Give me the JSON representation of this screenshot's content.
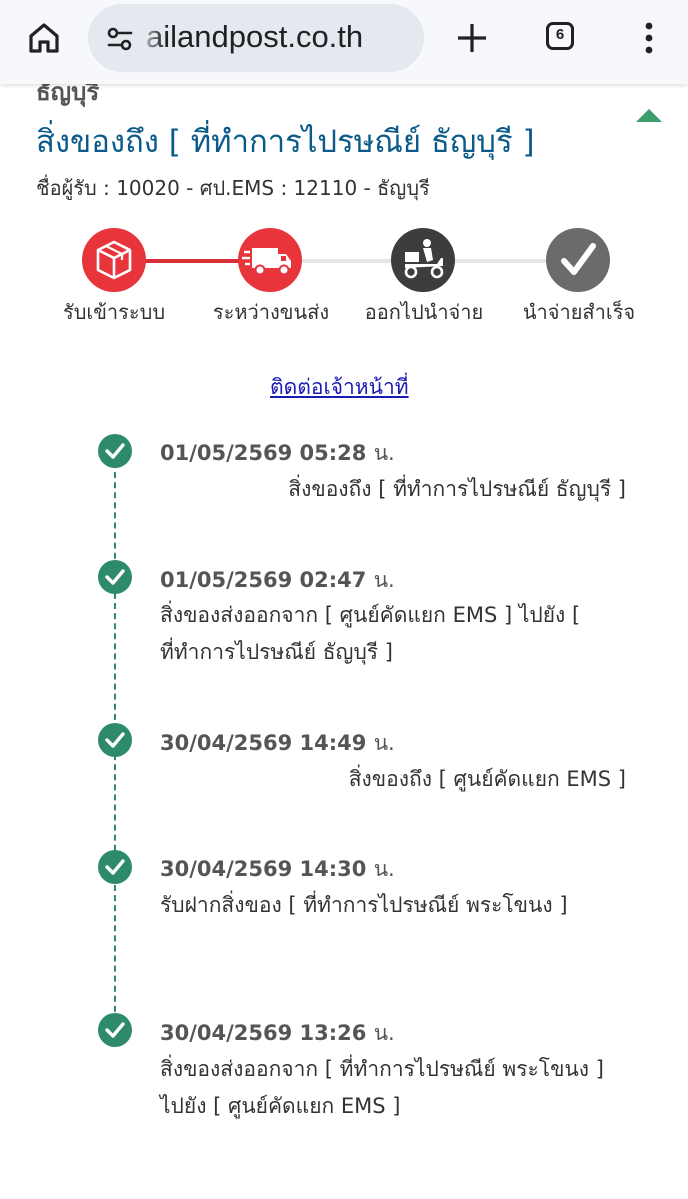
{
  "browser": {
    "url": "ailandpost.co.th",
    "tab_count": "6",
    "icons": [
      "home-icon",
      "site-info-icon",
      "plus-icon",
      "tabs-icon",
      "more-vert-icon"
    ]
  },
  "header": {
    "cut_text": "ธัญบุรี",
    "title": "สิ่งของถึง [ ที่ทำการไปรษณีย์ ธัญบุรี ]",
    "recipient": "ชื่อผู้รับ : 10020 - ศป.EMS : 12110 - ธัญบุรี"
  },
  "progress": {
    "steps": [
      {
        "label": "รับเข้าระบบ",
        "icon": "package-icon",
        "color": "#e8343b"
      },
      {
        "label": "ระหว่างขนส่ง",
        "icon": "truck-icon",
        "color": "#e8343b"
      },
      {
        "label": "ออกไปนำจ่าย",
        "icon": "scooter-icon",
        "color": "#3d3d3d"
      },
      {
        "label": "นำจ่ายสำเร็จ",
        "icon": "checkmark-icon",
        "color": "#6b6b6b"
      }
    ],
    "completed_steps": 2
  },
  "contact": {
    "label": "ติดต่อเจ้าหน้าที่"
  },
  "timeline": {
    "unit": "น.",
    "events": [
      {
        "datetime": "01/05/2569 05:28",
        "desc": "สิ่งของถึง [ ที่ทำการไปรษณีย์ ธัญบุรี ]"
      },
      {
        "datetime": "01/05/2569 02:47",
        "desc": "สิ่งของส่งออกจาก [ ศูนย์คัดแยก EMS ] ไปยัง [ ที่ทำการไปรษณีย์ ธัญบุรี ]"
      },
      {
        "datetime": "30/04/2569 14:49",
        "desc": "สิ่งของถึง [ ศูนย์คัดแยก EMS ]"
      },
      {
        "datetime": "30/04/2569 14:30",
        "desc": "รับฝากสิ่งของ [ ที่ทำการไปรษณีย์ พระโขนง ]"
      },
      {
        "datetime": "30/04/2569 13:26",
        "desc": "สิ่งของส่งออกจาก [ ที่ทำการไปรษณีย์ พระโขนง ] ไปยัง [ ศูนย์คัดแยก EMS ]"
      }
    ]
  },
  "colors": {
    "accent": "#0b5a8a",
    "progress_red": "#d62f36",
    "timeline_green": "#2e8b6a",
    "link": "#1a1ab5"
  }
}
